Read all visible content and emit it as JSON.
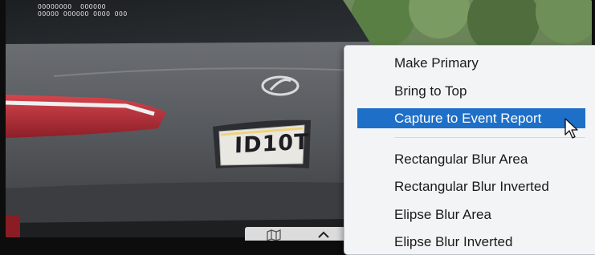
{
  "video": {
    "osd_lines": [
      "OOOOOOOO  OOOOOO",
      "OOOOO OOOOOO OOOO OOO"
    ],
    "plate": {
      "text": "ID10T",
      "state_text": ""
    }
  },
  "context_menu": {
    "items": [
      {
        "label": "Make Primary"
      },
      {
        "label": "Bring to Top"
      },
      {
        "label": "Capture to Event Report"
      },
      {
        "label": "Rectangular Blur Area"
      },
      {
        "label": "Rectangular Blur Inverted"
      },
      {
        "label": "Elipse Blur Area"
      },
      {
        "label": "Elipse Blur Inverted"
      }
    ],
    "highlighted_index": 2,
    "highlight_color": "#1e6fc7"
  },
  "toolbar": {
    "icons": [
      "map-icon",
      "chevron-up-icon"
    ]
  }
}
